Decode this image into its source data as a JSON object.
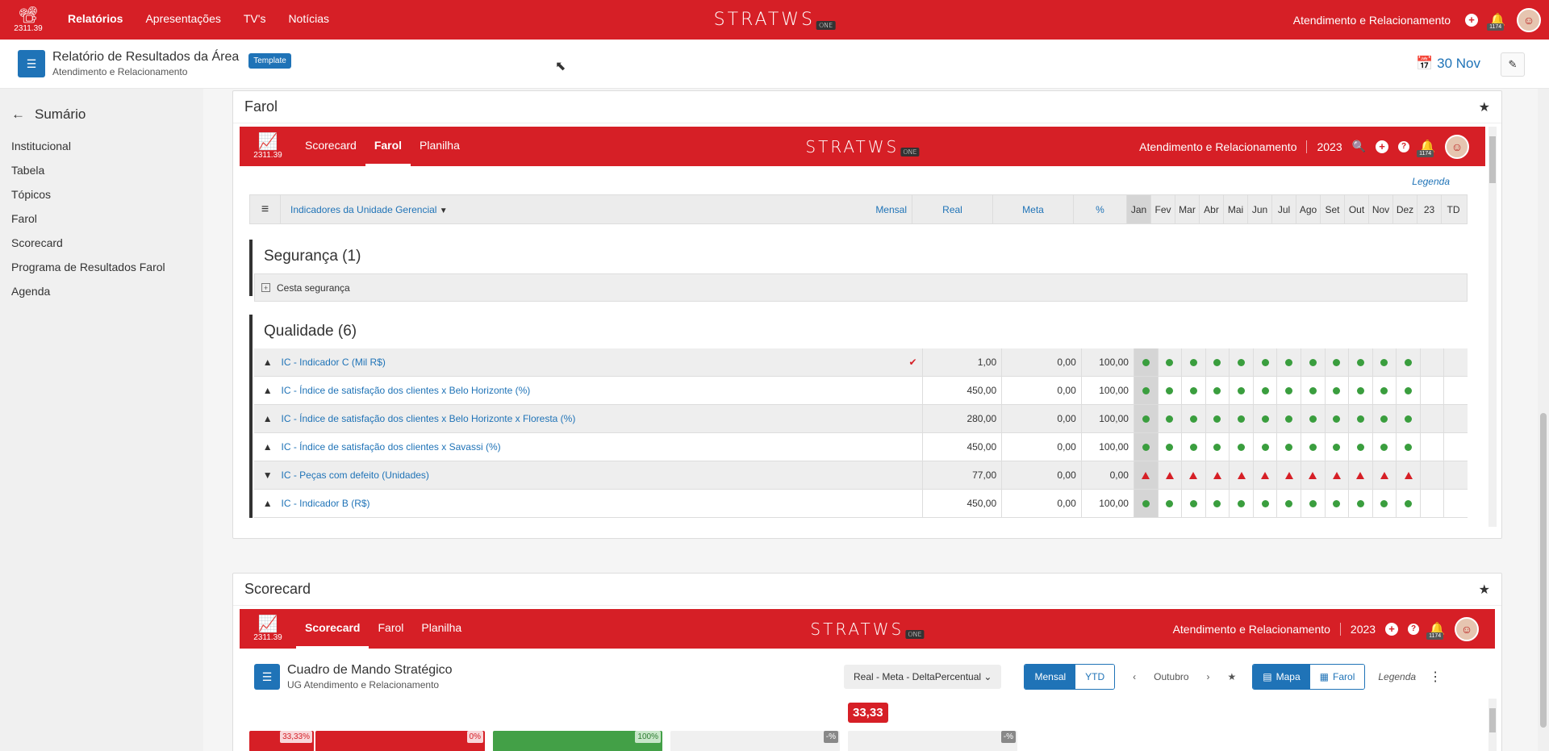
{
  "topbar": {
    "version": "2311.39",
    "nav": [
      "Relatórios",
      "Apresentações",
      "TV's",
      "Notícias"
    ],
    "logo": "STRATWS",
    "logo_suffix": "ONE",
    "unit": "Atendimento e Relacionamento",
    "notif_count": "1174"
  },
  "subheader": {
    "title": "Relatório de Resultados da Área",
    "subtitle": "Atendimento e Relacionamento",
    "badge": "Template",
    "date": "30 Nov"
  },
  "sidebar": {
    "title": "Sumário",
    "items": [
      "Institucional",
      "Tabela",
      "Tópicos",
      "Farol",
      "Scorecard",
      "Programa de Resultados Farol",
      "Agenda"
    ]
  },
  "farol_panel": {
    "title": "Farol",
    "inner": {
      "version": "2311.39",
      "tabs": [
        "Scorecard",
        "Farol",
        "Planilha"
      ],
      "unit": "Atendimento e Relacionamento",
      "year": "2023",
      "notif_count": "1174"
    },
    "legenda": "Legenda",
    "grid": {
      "dropdown": "Indicadores da Unidade Gerencial",
      "cols": [
        "Mensal",
        "Real",
        "Meta",
        "%"
      ],
      "months": [
        "Jan",
        "Fev",
        "Mar",
        "Abr",
        "Mai",
        "Jun",
        "Jul",
        "Ago",
        "Set",
        "Out",
        "Nov",
        "Dez",
        "23",
        "TD"
      ]
    },
    "seguranca": {
      "title": "Segurança (1)",
      "group": "Cesta segurança"
    },
    "qualidade": {
      "title": "Qualidade (6)",
      "rows": [
        {
          "name": "IC - Indicador C (Mil R$)",
          "dir": "up",
          "real": "1,00",
          "meta": "0,00",
          "pct": "100,00",
          "status": "green",
          "checked": true
        },
        {
          "name": "IC - Índice de satisfação dos clientes x Belo Horizonte (%)",
          "dir": "up",
          "real": "450,00",
          "meta": "0,00",
          "pct": "100,00",
          "status": "green",
          "checked": false
        },
        {
          "name": "IC - Índice de satisfação dos clientes x Belo Horizonte x Floresta (%)",
          "dir": "up",
          "real": "280,00",
          "meta": "0,00",
          "pct": "100,00",
          "status": "green",
          "checked": false
        },
        {
          "name": "IC - Índice de satisfação dos clientes x Savassi (%)",
          "dir": "up",
          "real": "450,00",
          "meta": "0,00",
          "pct": "100,00",
          "status": "green",
          "checked": false
        },
        {
          "name": "IC - Peças com defeito (Unidades)",
          "dir": "down",
          "real": "77,00",
          "meta": "0,00",
          "pct": "0,00",
          "status": "red",
          "checked": false
        },
        {
          "name": "IC - Indicador B (R$)",
          "dir": "up",
          "real": "450,00",
          "meta": "0,00",
          "pct": "100,00",
          "status": "green",
          "checked": false
        }
      ]
    }
  },
  "scorecard_panel": {
    "title": "Scorecard",
    "inner": {
      "version": "2311.39",
      "tabs": [
        "Scorecard",
        "Farol",
        "Planilha"
      ],
      "unit": "Atendimento e Relacionamento",
      "year": "2023",
      "notif_count": "1174"
    },
    "toolbar": {
      "title": "Cuadro de Mando Stratégico",
      "subtitle": "UG Atendimento e Relacionamento",
      "metric": "Real - Meta - DeltaPercentual",
      "period_tabs": [
        "Mensal",
        "YTD"
      ],
      "month": "Outubro",
      "view_tabs": [
        "Mapa",
        "Farol"
      ],
      "legenda": "Legenda"
    },
    "big_value": "33,33",
    "tiles": [
      {
        "pct": "33,33%",
        "color": "#d61f26"
      },
      {
        "pct": "0%",
        "color": "#d61f26"
      },
      {
        "pct": "100%",
        "color": "#43a047"
      },
      {
        "pct": "-%",
        "color": "#f0f0f0"
      },
      {
        "pct": "-%",
        "color": "#f0f0f0"
      }
    ]
  }
}
